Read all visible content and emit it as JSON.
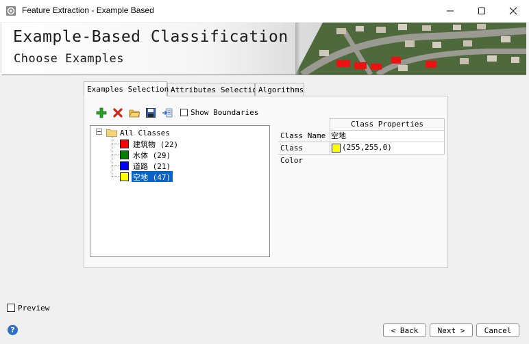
{
  "window": {
    "title": "Feature Extraction - Example Based"
  },
  "banner": {
    "title": "Example-Based Classification",
    "subtitle": "Choose Examples"
  },
  "tabs": [
    {
      "label": "Examples Selection",
      "active": true
    },
    {
      "label": "Attributes Selection",
      "active": false
    },
    {
      "label": "Algorithms",
      "active": false
    }
  ],
  "toolbar": {
    "icons": [
      "add-icon",
      "delete-icon",
      "open-folder-icon",
      "save-icon",
      "import-icon"
    ],
    "show_boundaries_label": "Show Boundaries",
    "show_boundaries_checked": false
  },
  "tree": {
    "root_label": "All Classes",
    "classes": [
      {
        "label": "建筑物 (22)",
        "color": "#ff0000"
      },
      {
        "label": "水体 (29)",
        "color": "#008000"
      },
      {
        "label": "道路 (21)",
        "color": "#0000ff"
      },
      {
        "label": "空地 (47)",
        "color": "#ffff00",
        "selected": true
      }
    ]
  },
  "properties": {
    "header": "Class Properties",
    "rows": [
      {
        "label": "Class Name",
        "value": "空地"
      },
      {
        "label": "Class Color",
        "value": "(255,255,0)",
        "swatch": "#ffff00"
      }
    ]
  },
  "footer": {
    "preview_label": "Preview",
    "preview_checked": false,
    "help_glyph": "?",
    "back_label": "< Back",
    "next_label": "Next >",
    "cancel_label": "Cancel"
  }
}
